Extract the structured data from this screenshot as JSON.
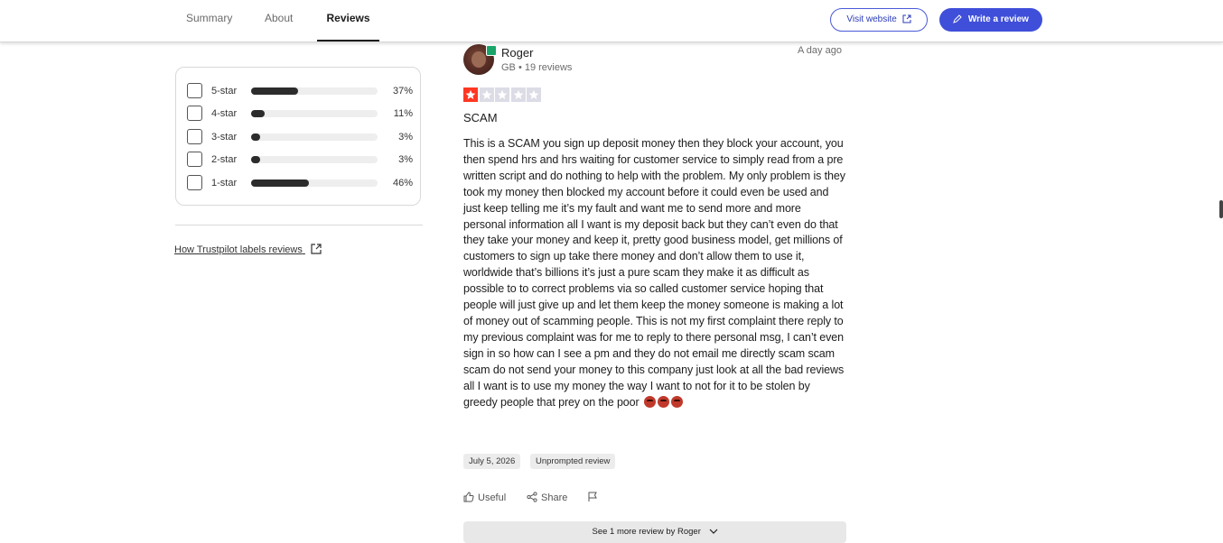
{
  "nav": {
    "tabs": [
      {
        "label": "Summary",
        "active": false
      },
      {
        "label": "About",
        "active": false
      },
      {
        "label": "Reviews",
        "active": true
      }
    ],
    "visit_label": "Visit website",
    "write_label": "Write a review",
    "accent": "#3f4fd9"
  },
  "filters": {
    "rows": [
      {
        "label": "5-star",
        "percent": 37,
        "percent_text": "37%"
      },
      {
        "label": "4-star",
        "percent": 11,
        "percent_text": "11%"
      },
      {
        "label": "3-star",
        "percent": 3,
        "percent_text": "3%"
      },
      {
        "label": "2-star",
        "percent": 3,
        "percent_text": "3%"
      },
      {
        "label": "1-star",
        "percent": 46,
        "percent_text": "46%"
      }
    ],
    "how_link": "How Trustpilot labels reviews"
  },
  "review": {
    "name": "Roger",
    "meta": "GB • 19 reviews",
    "posted": "A day ago",
    "rating": 1,
    "star_color": "#ff3722",
    "title": "SCAM",
    "body": "This is a SCAM you sign up deposit money then they block your account, you then spend hrs and hrs waiting for customer service to simply read from a pre written script and do nothing to help with the problem. My only problem is they took my money then blocked my account before it could even be used and just keep telling me it’s my fault and want me to send more and more personal information all I want is my deposit back but they can’t even do that they take your money and keep it, pretty good business model, get millions of customers to sign up take there money and don’t allow them to use it, worldwide that’s billions it’s just a pure scam they make it as difficult as possible to to correct problems via so called customer service hoping that people will just give up and let them keep the money someone is making a lot of money out of scamming people. This is not my first complaint there reply to my previous complaint was for me to reply to there personal msg, I can’t even sign in so how can I see a pm and they do not email me directly scam scam scam do not send your money to this company just look at all the bad reviews all I want is to use my money the way I want to not for it to be stolen by greedy people that prey on the poor",
    "emoji_icons": [
      "angry-face-icon",
      "angry-face-icon",
      "angry-face-icon"
    ],
    "experience_date": "July 5, 2026",
    "badge": "Unprompted review",
    "useful_label": "Useful",
    "share_label": "Share",
    "see_more_label": "See 1 more review by Roger"
  }
}
